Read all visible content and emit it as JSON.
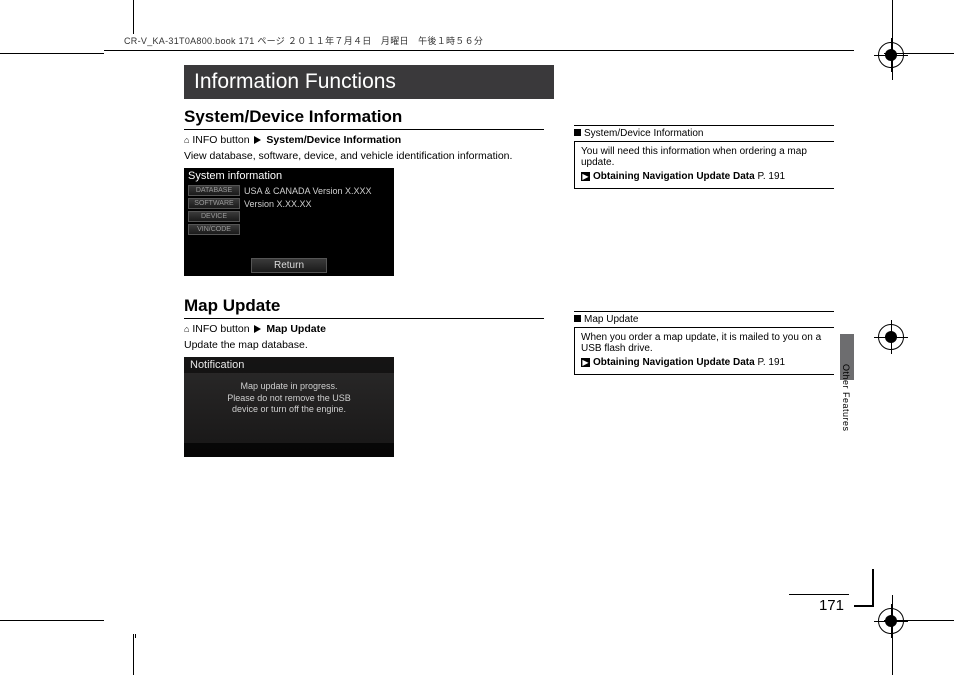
{
  "meta": {
    "header_text": "CR-V_KA-31T0A800.book  171 ページ  ２０１１年７月４日　月曜日　午後１時５６分"
  },
  "banner": "Information Functions",
  "section1": {
    "title": "System/Device Information",
    "crumb_prefix": "INFO button",
    "crumb_target": "System/Device Information",
    "desc": "View database, software, device, and vehicle identification information.",
    "screen": {
      "title": "System information",
      "rows": {
        "b1": "DATABASE",
        "v1": "USA & CANADA Version X.XXX",
        "b2": "SOFTWARE",
        "v2": "Version X.XX.XX",
        "b3": "DEVICE",
        "b4": "VIN/CODE"
      },
      "return": "Return"
    }
  },
  "section2": {
    "title": "Map Update",
    "crumb_prefix": "INFO button",
    "crumb_target": "Map Update",
    "desc": "Update the map database.",
    "screen": {
      "title": "Notification",
      "l1": "Map update in progress.",
      "l2": "Please do not remove the USB",
      "l3": "device or turn off the engine."
    }
  },
  "side1": {
    "head": "System/Device Information",
    "body": "You will need this information when ordering a map update.",
    "link": "Obtaining Navigation Update Data",
    "page_ref": "P. 191"
  },
  "side2": {
    "head": "Map Update",
    "body": "When you order a map update, it is mailed to you on a USB flash drive.",
    "link": "Obtaining Navigation Update Data",
    "page_ref": "P. 191"
  },
  "tab_label": "Other Features",
  "page_number": "171"
}
